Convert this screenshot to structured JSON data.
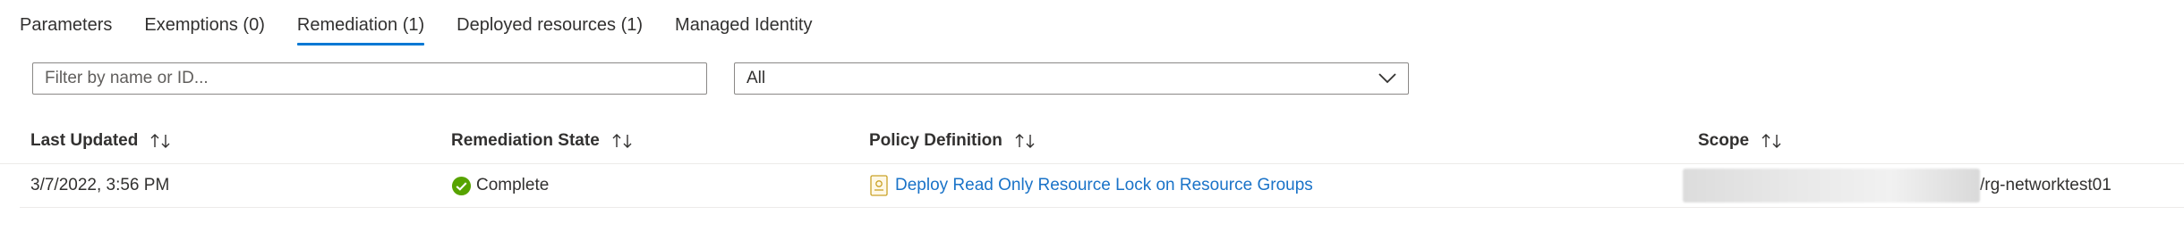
{
  "tabs": [
    {
      "label": "Parameters",
      "active": false
    },
    {
      "label": "Exemptions (0)",
      "active": false
    },
    {
      "label": "Remediation (1)",
      "active": true
    },
    {
      "label": "Deployed resources (1)",
      "active": false
    },
    {
      "label": "Managed Identity",
      "active": false
    }
  ],
  "filters": {
    "search_placeholder": "Filter by name or ID...",
    "search_value": "",
    "state_selected": "All"
  },
  "table": {
    "columns": [
      {
        "label": "Last Updated"
      },
      {
        "label": "Remediation State"
      },
      {
        "label": "Policy Definition"
      },
      {
        "label": "Scope"
      }
    ],
    "rows": [
      {
        "last_updated": "3/7/2022, 3:56 PM",
        "state": "Complete",
        "state_color": "#57a300",
        "policy_definition": "Deploy Read Only Resource Lock on Resource Groups",
        "scope_visible": "/rg-networktest01"
      }
    ]
  },
  "colors": {
    "accent": "#0078d4",
    "link": "#1a73c8",
    "success": "#57a300"
  },
  "icons": {
    "sort": "sort-updown-icon",
    "dropdown": "chevron-down-icon",
    "status": "check-circle-icon",
    "policy": "policy-definition-icon"
  }
}
